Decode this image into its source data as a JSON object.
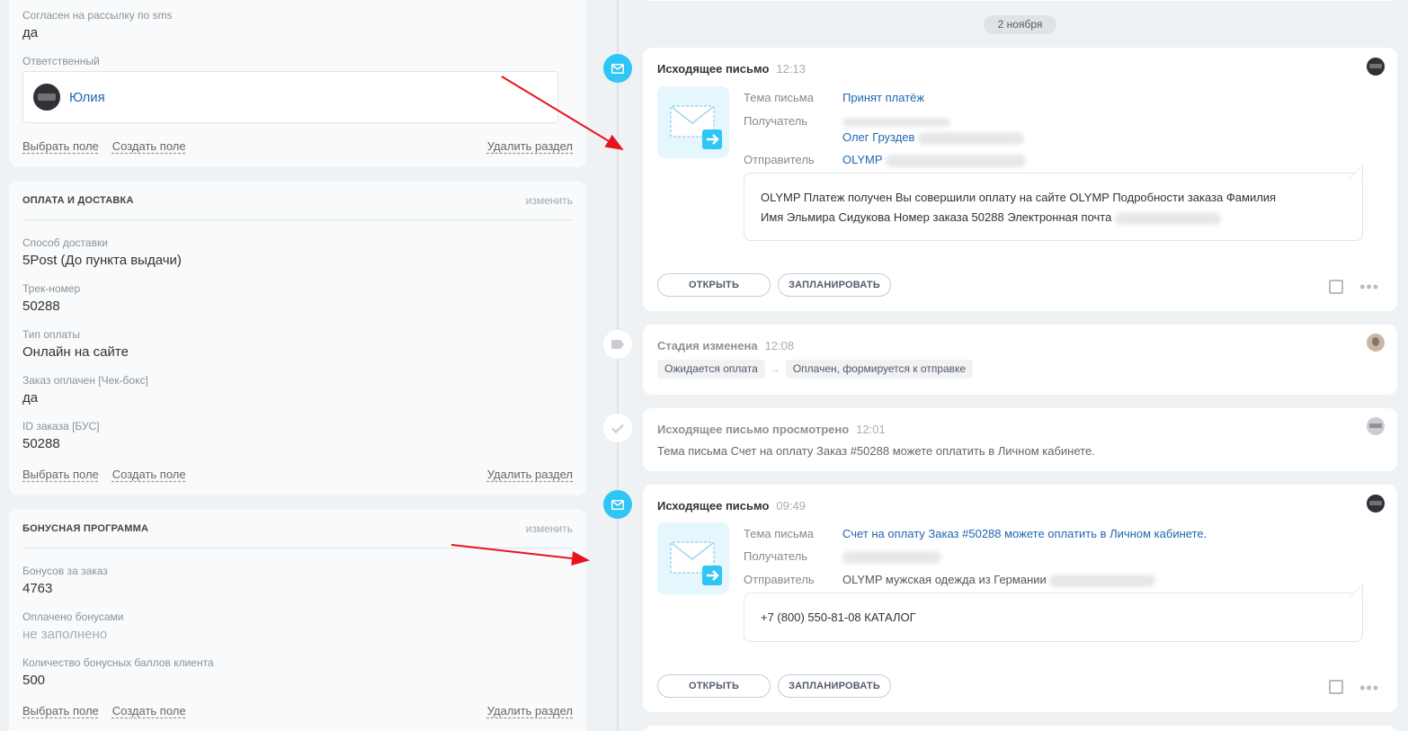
{
  "left": {
    "panel1": {
      "sms_label": "Согласен на рассылку по sms",
      "sms_value": "да",
      "responsible_label": "Ответственный",
      "responsible_name": "Юлия",
      "select_field": "Выбрать поле",
      "create_field": "Создать поле",
      "delete_section": "Удалить раздел"
    },
    "panel2": {
      "title": "ОПЛАТА И ДОСТАВКА",
      "edit": "изменить",
      "fields": [
        {
          "label": "Способ доставки",
          "value": "5Post (До пункта выдачи)"
        },
        {
          "label": "Трек-номер",
          "value": "50288"
        },
        {
          "label": "Тип оплаты",
          "value": "Онлайн на сайте"
        },
        {
          "label": "Заказ оплачен [Чек-бокс]",
          "value": "да"
        },
        {
          "label": "ID заказа [БУС]",
          "value": "50288"
        }
      ],
      "select_field": "Выбрать поле",
      "create_field": "Создать поле",
      "delete_section": "Удалить раздел"
    },
    "panel3": {
      "title": "БОНУСНАЯ ПРОГРАММА",
      "edit": "изменить",
      "fields": [
        {
          "label": "Бонусов за заказ",
          "value": "4763"
        },
        {
          "label": "Оплачено бонусами",
          "value": "не заполнено"
        },
        {
          "label": "Количество бонусных баллов клиента",
          "value": "500"
        }
      ],
      "select_field": "Выбрать поле",
      "create_field": "Создать поле",
      "delete_section": "Удалить раздел"
    }
  },
  "timeline": {
    "date": "2 ноября",
    "email1": {
      "title": "Исходящее письмо",
      "time": "12:13",
      "subject_label": "Тема письма",
      "subject": "Принят платёж",
      "recipient_label": "Получатель",
      "recipient_name": "Олег Груздев",
      "sender_label": "Отправитель",
      "sender": "OLYMP",
      "body_line1": "OLYMP Платеж получен Вы совершили оплату на сайте OLYMP Подробности заказа Фамилия",
      "body_line2": "Имя Эльмира Сидукова Номер заказа 50288 Электронная почта",
      "open": "ОТКРЫТЬ",
      "plan": "ЗАПЛАНИРОВАТЬ"
    },
    "stage": {
      "title": "Стадия изменена",
      "time": "12:08",
      "from": "Ожидается оплата",
      "to": "Оплачен, формируется к отправке"
    },
    "viewed": {
      "title": "Исходящее письмо просмотрено",
      "time": "12:01",
      "text": "Тема письма Счет на оплату Заказ #50288 можете оплатить в Личном кабинете."
    },
    "email2": {
      "title": "Исходящее письмо",
      "time": "09:49",
      "subject_label": "Тема письма",
      "subject": "Счет на оплату Заказ #50288 можете оплатить в Личном кабинете.",
      "recipient_label": "Получатель",
      "sender_label": "Отправитель",
      "sender": "OLYMP мужская одежда из Германии",
      "body": "+7 (800) 550-81-08 КАТАЛОГ",
      "open": "ОТКРЫТЬ",
      "plan": "ЗАПЛАНИРОВАТЬ"
    }
  },
  "colors": {
    "accent_blue": "#2fc6f6",
    "link_blue": "#2067b0",
    "annotation_red": "#e8141c"
  }
}
